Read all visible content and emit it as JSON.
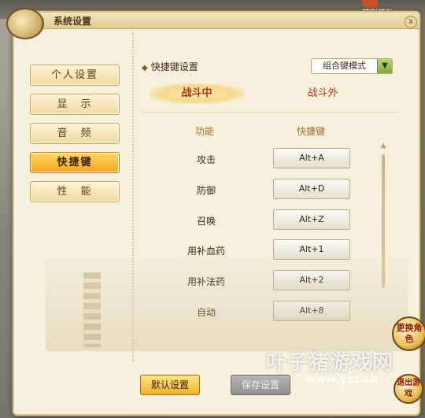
{
  "window": {
    "title": "系统设置",
    "close_glyph": "x"
  },
  "top_event": "精彩活动",
  "nav": [
    {
      "label": "个人设置",
      "active": false
    },
    {
      "label": "显　示",
      "active": false
    },
    {
      "label": "音　频",
      "active": false
    },
    {
      "label": "快捷键",
      "active": true
    },
    {
      "label": "性　能",
      "active": false
    }
  ],
  "section": {
    "diamond": "◆",
    "title": "快捷键设置"
  },
  "mode_select": {
    "value": "组合键模式",
    "arrow": "▼"
  },
  "tabs": [
    {
      "label": "战斗中",
      "active": true
    },
    {
      "label": "战斗外",
      "active": false
    }
  ],
  "columns": {
    "function": "功能",
    "hotkey": "快捷键"
  },
  "rows": [
    {
      "function": "攻击",
      "key": "Alt+A"
    },
    {
      "function": "防御",
      "key": "Alt+D"
    },
    {
      "function": "召唤",
      "key": "Alt+Z"
    },
    {
      "function": "用补血药",
      "key": "Alt+1"
    },
    {
      "function": "用补法药",
      "key": "Alt+2"
    },
    {
      "function": "自动",
      "key": "Alt+8"
    }
  ],
  "scroll": {
    "up": "▲",
    "down": "▼"
  },
  "footer": {
    "default_button": "默认设置",
    "save_button": "保存设置"
  },
  "orbs": {
    "swap": "更换角色",
    "exit": "退出游戏"
  },
  "watermark": {
    "text": "叶子猪游戏网",
    "url": "www.yzz.cn"
  }
}
